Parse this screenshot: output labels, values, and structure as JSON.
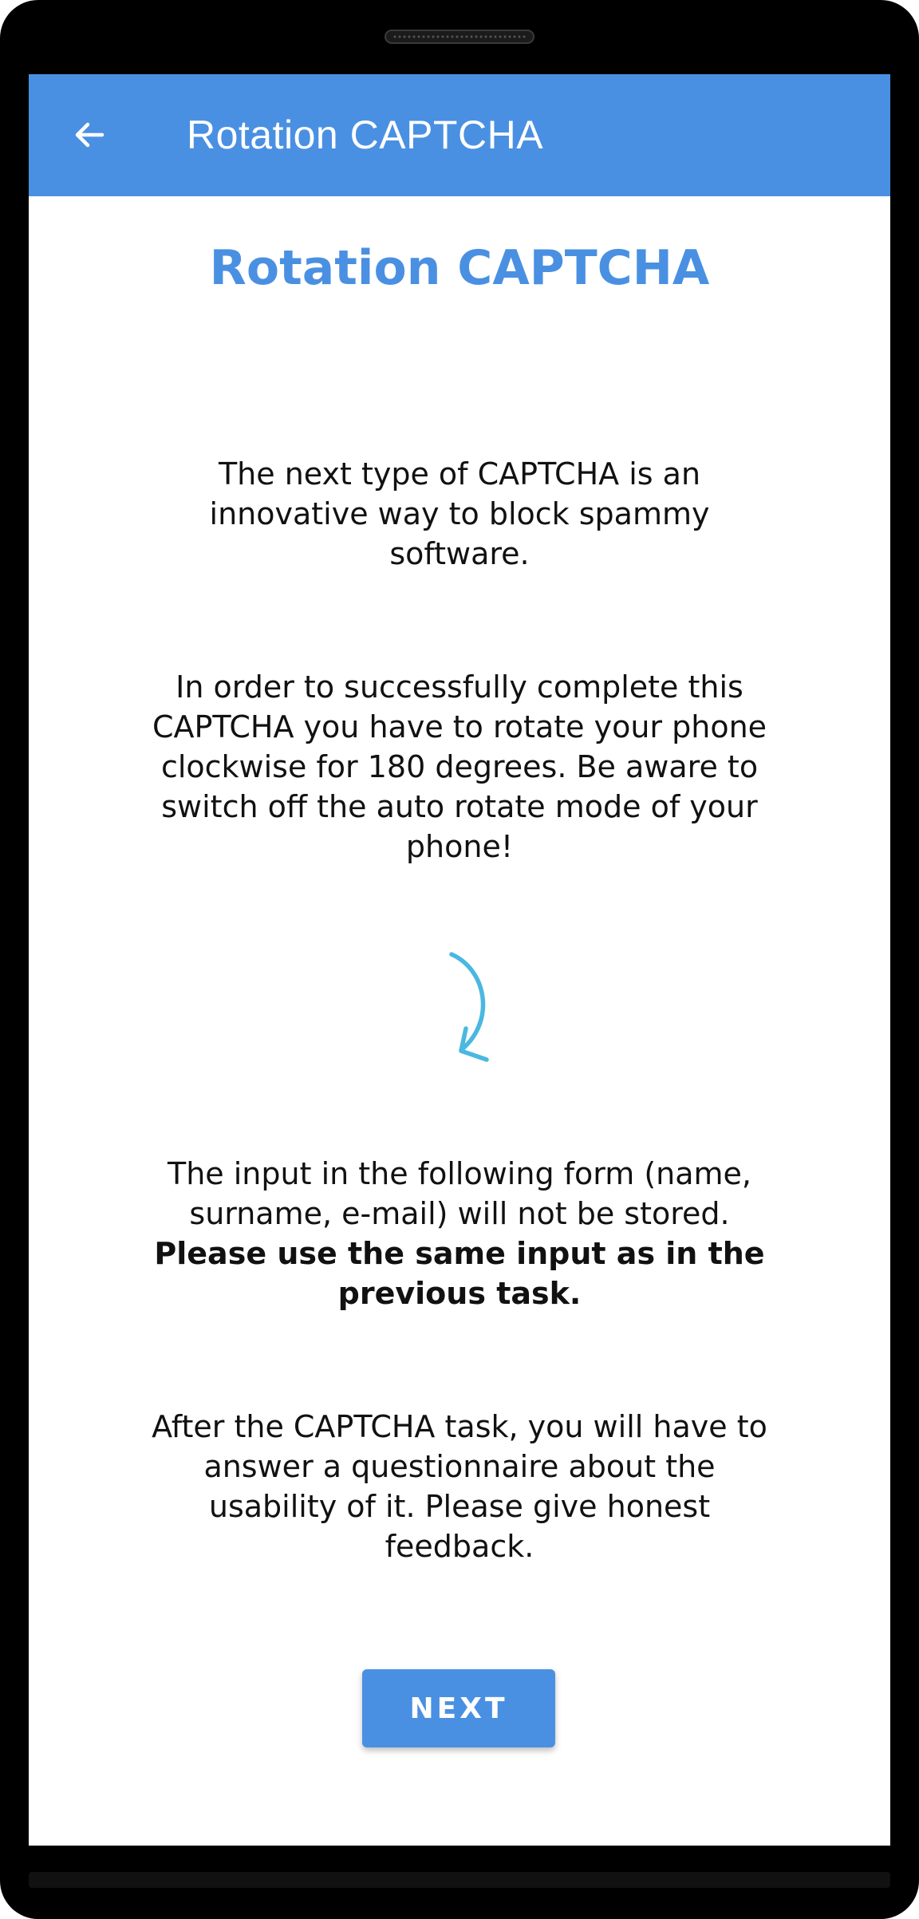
{
  "appbar": {
    "title": "Rotation CAPTCHA",
    "back_icon": "arrow-left-icon"
  },
  "main": {
    "heading": "Rotation CAPTCHA",
    "paragraph_1": "The next type of CAPTCHA is an innovative way to block spammy software.",
    "paragraph_2": "In order to successfully complete this CAPTCHA you have to rotate your phone clockwise for 180 degrees. Be aware to switch off the auto rotate mode of your phone!",
    "paragraph_3": "The input in the following form (name, surname, e-mail) will not be stored.",
    "paragraph_3_bold": "Please use the same input as in the previous task.",
    "paragraph_4": "After the CAPTCHA task, you will have to answer a questionnaire about the usability of it. Please give honest feedback.",
    "rotate_icon": "rotate-clockwise-arrow-icon",
    "next_button": "NEXT"
  },
  "colors": {
    "accent": "#4a90e2",
    "arrow": "#4ab8e0",
    "text": "#111111",
    "frame": "#000000"
  }
}
